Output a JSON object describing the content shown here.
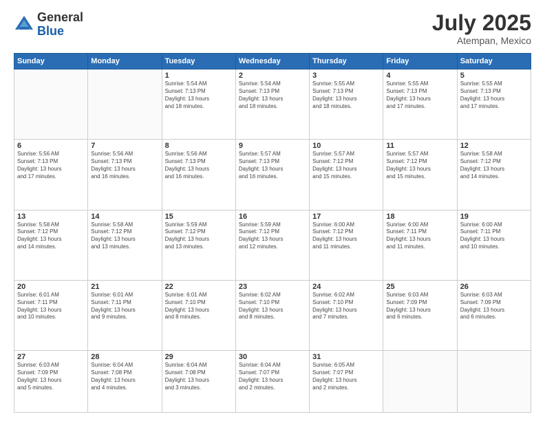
{
  "header": {
    "logo_general": "General",
    "logo_blue": "Blue",
    "month_year": "July 2025",
    "location": "Atempan, Mexico"
  },
  "weekdays": [
    "Sunday",
    "Monday",
    "Tuesday",
    "Wednesday",
    "Thursday",
    "Friday",
    "Saturday"
  ],
  "weeks": [
    [
      {
        "day": "",
        "lines": []
      },
      {
        "day": "",
        "lines": []
      },
      {
        "day": "1",
        "lines": [
          "Sunrise: 5:54 AM",
          "Sunset: 7:13 PM",
          "Daylight: 13 hours",
          "and 18 minutes."
        ]
      },
      {
        "day": "2",
        "lines": [
          "Sunrise: 5:54 AM",
          "Sunset: 7:13 PM",
          "Daylight: 13 hours",
          "and 18 minutes."
        ]
      },
      {
        "day": "3",
        "lines": [
          "Sunrise: 5:55 AM",
          "Sunset: 7:13 PM",
          "Daylight: 13 hours",
          "and 18 minutes."
        ]
      },
      {
        "day": "4",
        "lines": [
          "Sunrise: 5:55 AM",
          "Sunset: 7:13 PM",
          "Daylight: 13 hours",
          "and 17 minutes."
        ]
      },
      {
        "day": "5",
        "lines": [
          "Sunrise: 5:55 AM",
          "Sunset: 7:13 PM",
          "Daylight: 13 hours",
          "and 17 minutes."
        ]
      }
    ],
    [
      {
        "day": "6",
        "lines": [
          "Sunrise: 5:56 AM",
          "Sunset: 7:13 PM",
          "Daylight: 13 hours",
          "and 17 minutes."
        ]
      },
      {
        "day": "7",
        "lines": [
          "Sunrise: 5:56 AM",
          "Sunset: 7:13 PM",
          "Daylight: 13 hours",
          "and 16 minutes."
        ]
      },
      {
        "day": "8",
        "lines": [
          "Sunrise: 5:56 AM",
          "Sunset: 7:13 PM",
          "Daylight: 13 hours",
          "and 16 minutes."
        ]
      },
      {
        "day": "9",
        "lines": [
          "Sunrise: 5:57 AM",
          "Sunset: 7:13 PM",
          "Daylight: 13 hours",
          "and 16 minutes."
        ]
      },
      {
        "day": "10",
        "lines": [
          "Sunrise: 5:57 AM",
          "Sunset: 7:12 PM",
          "Daylight: 13 hours",
          "and 15 minutes."
        ]
      },
      {
        "day": "11",
        "lines": [
          "Sunrise: 5:57 AM",
          "Sunset: 7:12 PM",
          "Daylight: 13 hours",
          "and 15 minutes."
        ]
      },
      {
        "day": "12",
        "lines": [
          "Sunrise: 5:58 AM",
          "Sunset: 7:12 PM",
          "Daylight: 13 hours",
          "and 14 minutes."
        ]
      }
    ],
    [
      {
        "day": "13",
        "lines": [
          "Sunrise: 5:58 AM",
          "Sunset: 7:12 PM",
          "Daylight: 13 hours",
          "and 14 minutes."
        ]
      },
      {
        "day": "14",
        "lines": [
          "Sunrise: 5:58 AM",
          "Sunset: 7:12 PM",
          "Daylight: 13 hours",
          "and 13 minutes."
        ]
      },
      {
        "day": "15",
        "lines": [
          "Sunrise: 5:59 AM",
          "Sunset: 7:12 PM",
          "Daylight: 13 hours",
          "and 13 minutes."
        ]
      },
      {
        "day": "16",
        "lines": [
          "Sunrise: 5:59 AM",
          "Sunset: 7:12 PM",
          "Daylight: 13 hours",
          "and 12 minutes."
        ]
      },
      {
        "day": "17",
        "lines": [
          "Sunrise: 6:00 AM",
          "Sunset: 7:12 PM",
          "Daylight: 13 hours",
          "and 11 minutes."
        ]
      },
      {
        "day": "18",
        "lines": [
          "Sunrise: 6:00 AM",
          "Sunset: 7:11 PM",
          "Daylight: 13 hours",
          "and 11 minutes."
        ]
      },
      {
        "day": "19",
        "lines": [
          "Sunrise: 6:00 AM",
          "Sunset: 7:11 PM",
          "Daylight: 13 hours",
          "and 10 minutes."
        ]
      }
    ],
    [
      {
        "day": "20",
        "lines": [
          "Sunrise: 6:01 AM",
          "Sunset: 7:11 PM",
          "Daylight: 13 hours",
          "and 10 minutes."
        ]
      },
      {
        "day": "21",
        "lines": [
          "Sunrise: 6:01 AM",
          "Sunset: 7:11 PM",
          "Daylight: 13 hours",
          "and 9 minutes."
        ]
      },
      {
        "day": "22",
        "lines": [
          "Sunrise: 6:01 AM",
          "Sunset: 7:10 PM",
          "Daylight: 13 hours",
          "and 8 minutes."
        ]
      },
      {
        "day": "23",
        "lines": [
          "Sunrise: 6:02 AM",
          "Sunset: 7:10 PM",
          "Daylight: 13 hours",
          "and 8 minutes."
        ]
      },
      {
        "day": "24",
        "lines": [
          "Sunrise: 6:02 AM",
          "Sunset: 7:10 PM",
          "Daylight: 13 hours",
          "and 7 minutes."
        ]
      },
      {
        "day": "25",
        "lines": [
          "Sunrise: 6:03 AM",
          "Sunset: 7:09 PM",
          "Daylight: 13 hours",
          "and 6 minutes."
        ]
      },
      {
        "day": "26",
        "lines": [
          "Sunrise: 6:03 AM",
          "Sunset: 7:09 PM",
          "Daylight: 13 hours",
          "and 6 minutes."
        ]
      }
    ],
    [
      {
        "day": "27",
        "lines": [
          "Sunrise: 6:03 AM",
          "Sunset: 7:09 PM",
          "Daylight: 13 hours",
          "and 5 minutes."
        ]
      },
      {
        "day": "28",
        "lines": [
          "Sunrise: 6:04 AM",
          "Sunset: 7:08 PM",
          "Daylight: 13 hours",
          "and 4 minutes."
        ]
      },
      {
        "day": "29",
        "lines": [
          "Sunrise: 6:04 AM",
          "Sunset: 7:08 PM",
          "Daylight: 13 hours",
          "and 3 minutes."
        ]
      },
      {
        "day": "30",
        "lines": [
          "Sunrise: 6:04 AM",
          "Sunset: 7:07 PM",
          "Daylight: 13 hours",
          "and 2 minutes."
        ]
      },
      {
        "day": "31",
        "lines": [
          "Sunrise: 6:05 AM",
          "Sunset: 7:07 PM",
          "Daylight: 13 hours",
          "and 2 minutes."
        ]
      },
      {
        "day": "",
        "lines": []
      },
      {
        "day": "",
        "lines": []
      }
    ]
  ]
}
